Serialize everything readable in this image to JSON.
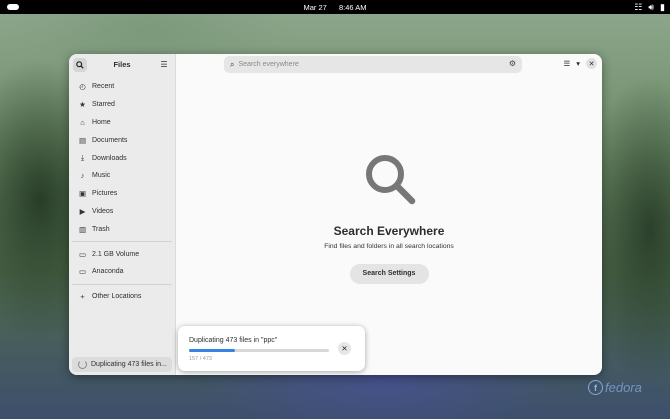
{
  "topbar": {
    "date": "Mar 27",
    "time": "8:46 AM"
  },
  "files": {
    "title": "Files",
    "search_placeholder": "Search everywhere",
    "sidebar": {
      "places": [
        {
          "label": "Recent",
          "icon": "clock-icon"
        },
        {
          "label": "Starred",
          "icon": "star-icon"
        },
        {
          "label": "Home",
          "icon": "home-icon"
        },
        {
          "label": "Documents",
          "icon": "document-icon"
        },
        {
          "label": "Downloads",
          "icon": "download-icon"
        },
        {
          "label": "Music",
          "icon": "music-icon"
        },
        {
          "label": "Pictures",
          "icon": "picture-icon"
        },
        {
          "label": "Videos",
          "icon": "video-icon"
        },
        {
          "label": "Trash",
          "icon": "trash-icon"
        }
      ],
      "devices": [
        {
          "label": "2.1 GB Volume",
          "icon": "drive-icon"
        },
        {
          "label": "Anaconda",
          "icon": "drive-icon"
        }
      ],
      "other": {
        "label": "Other Locations",
        "icon": "plus-icon"
      },
      "operation": "Duplicating 473 files in..."
    },
    "empty": {
      "title": "Search Everywhere",
      "subtitle": "Find files and folders in all search locations",
      "button": "Search Settings"
    },
    "progress": {
      "title": "Duplicating 473 files in \"ppc\"",
      "count": "157 / 473",
      "fraction": 0.332
    }
  },
  "branding": {
    "logo_text": "fedora"
  }
}
